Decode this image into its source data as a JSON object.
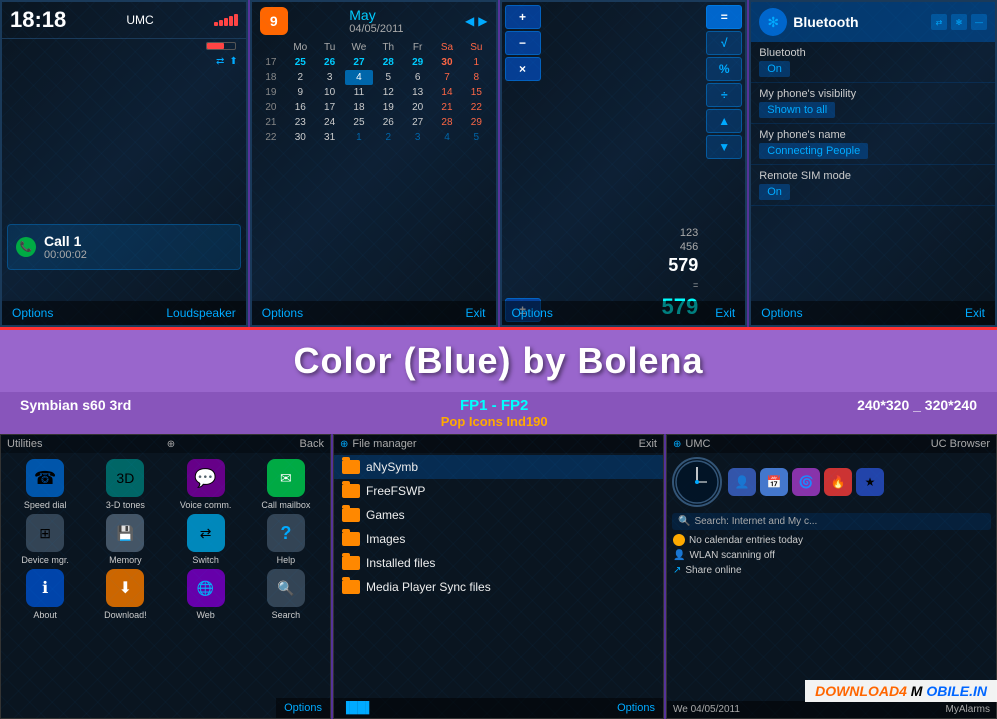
{
  "topRow": {
    "screen1": {
      "time": "18:18",
      "operator": "UMC",
      "callName": "Call 1",
      "callTimer": "00:00:02",
      "bottomLeft": "Options",
      "bottomRight": "Loudspeaker"
    },
    "screen2": {
      "month": "May",
      "appNum": "9",
      "date": "04/05/2011",
      "headers": [
        "Mo",
        "Tu",
        "We",
        "Th",
        "Fr",
        "Sa",
        "Su"
      ],
      "bottomLeft": "Options",
      "bottomRight": "Exit"
    },
    "screen3": {
      "line1": "123",
      "line2": "456",
      "result": "579",
      "bottomLeft": "Options",
      "bottomRight": "Exit"
    },
    "screen4": {
      "title": "Bluetooth",
      "item1Label": "Bluetooth",
      "item1Value": "On",
      "item2Label": "My phone's visibility",
      "item2Value": "Shown to all",
      "item3Label": "My phone's name",
      "item3Value": "Connecting People",
      "item4Label": "Remote SIM mode",
      "item4Value": "On",
      "bottomLeft": "Options",
      "bottomRight": "Exit"
    }
  },
  "titleSection": {
    "mainTitle": "Color (Blue) by Bolena",
    "infoLeft": "Symbian s60 3rd",
    "infoCenter1": "FP1 - FP2",
    "infoCenter2": "Pop Icons Ind190",
    "infoRight": "240*320 _ 320*240"
  },
  "bottomRow": {
    "screen1": {
      "headerLeft": "Utilities",
      "headerRight": "Back",
      "items": [
        {
          "label": "Speed dial",
          "icon": "☎",
          "iconClass": "icon-blue"
        },
        {
          "label": "3-D tones",
          "icon": "🎵",
          "iconClass": "icon-teal"
        },
        {
          "label": "Voice comm.",
          "icon": "💬",
          "iconClass": "icon-purple"
        },
        {
          "label": "Call mailbox",
          "icon": "📞",
          "iconClass": "icon-green"
        },
        {
          "label": "Device mgr.",
          "icon": "⚙",
          "iconClass": "icon-gray"
        },
        {
          "label": "Memory",
          "icon": "💾",
          "iconClass": "icon-gray"
        },
        {
          "label": "Switch",
          "icon": "⇄",
          "iconClass": "icon-lightblue"
        },
        {
          "label": "Help",
          "icon": "?",
          "iconClass": "icon-dark"
        },
        {
          "label": "About",
          "icon": "ℹ",
          "iconClass": "icon-blue"
        },
        {
          "label": "Download!",
          "icon": "⬇",
          "iconClass": "icon-orange"
        },
        {
          "label": "Web",
          "icon": "🌐",
          "iconClass": "icon-purple"
        },
        {
          "label": "Search",
          "icon": "🔍",
          "iconClass": "icon-gray"
        }
      ],
      "bottomRight": "Options"
    },
    "screen2": {
      "headerLeft": "File manager",
      "headerRight": "Exit",
      "files": [
        "aNySymb",
        "FreeFSWP",
        "Games",
        "Images",
        "Installed files",
        "Media Player Sync files"
      ],
      "bottomRight": "Options"
    },
    "screen3": {
      "headerLeft": "UMC",
      "headerRight": "UC Browser",
      "searchText": "Search: Internet and My c...",
      "info1": "No calendar entries today",
      "info2": "WLAN scanning off",
      "info3": "Share online",
      "dateBar": "We 04/05/2011",
      "rightBar": "MyAlarms"
    }
  },
  "downloadBanner": {
    "text1": "DOWNLOAD4",
    "text2": "MOBILE.IN"
  }
}
